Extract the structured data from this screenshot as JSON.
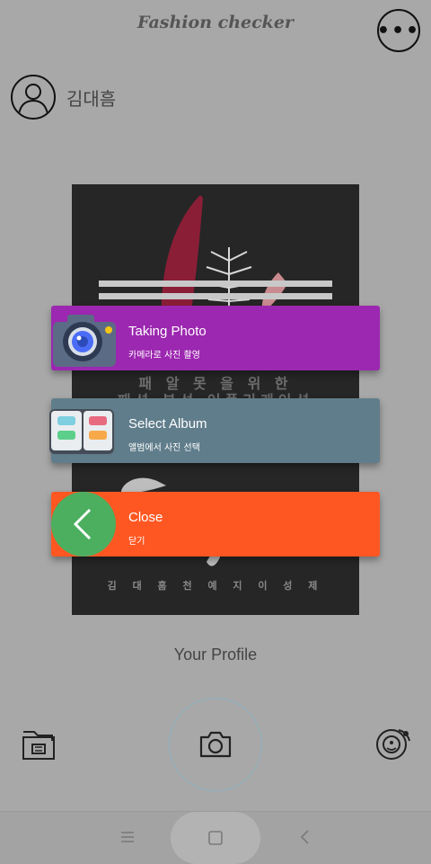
{
  "header": {
    "title": "Fashion checker",
    "more_icon": "more-dots-icon"
  },
  "user": {
    "name": "김대흠",
    "avatar_icon": "user-avatar-icon"
  },
  "poster": {
    "line1": "패 알 못 을  위 한",
    "line2": "패션 분석 어플리케이션",
    "names": "김 대 흠   천 예 지   이 성 제"
  },
  "popup": {
    "items": [
      {
        "title": "Taking Photo",
        "subtitle": "카메라로 사진 촬영",
        "color": "#9c27b0",
        "icon": "camera-icon"
      },
      {
        "title": "Select Album",
        "subtitle": "앨범에서 사진 선택",
        "color": "#607d8b",
        "icon": "album-icon"
      },
      {
        "title": "Close",
        "subtitle": "닫기",
        "color": "#ff5722",
        "icon": "back-arrow-icon"
      }
    ]
  },
  "profile_label": "Your Profile",
  "bottom_icons": {
    "left": "folder-icon",
    "center": "camera-icon",
    "right": "analysis-icon"
  },
  "nav": {
    "menu": "menu-icon",
    "home": "home-square-icon",
    "back": "back-icon"
  }
}
